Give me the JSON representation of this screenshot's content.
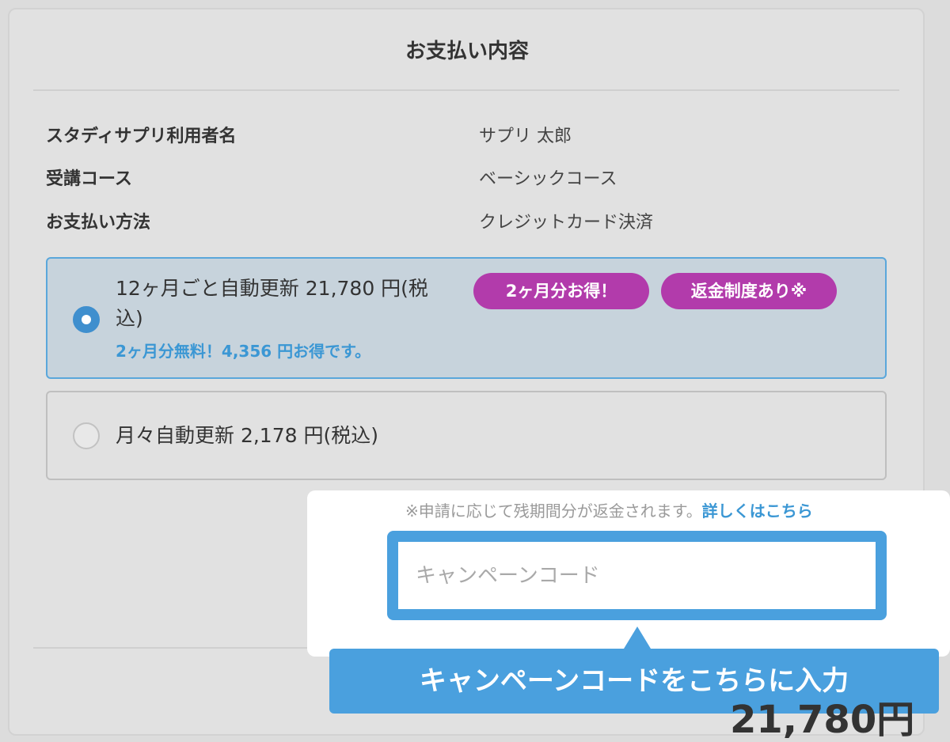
{
  "title": "お支払い内容",
  "details": [
    {
      "label": "スタディサプリ利用者名",
      "value": "サプリ 太郎"
    },
    {
      "label": "受講コース",
      "value": "ベーシックコース"
    },
    {
      "label": "お支払い方法",
      "value": "クレジットカード決済"
    }
  ],
  "plans": {
    "yearly": {
      "line1": "12ヶ月ごと自動更新 21,780 円(税",
      "line2": "込)",
      "note": "2ヶ月分無料！4,356 円お得です。",
      "badges": [
        "2ヶ月分お得！",
        "返金制度あり※"
      ],
      "selected": true
    },
    "monthly": {
      "label": "月々自動更新 2,178 円(税込)",
      "selected": false
    }
  },
  "refund": {
    "note": "※申請に応じて残期間分が返金されます。",
    "link": "詳しくはこちら"
  },
  "campaign": {
    "placeholder": "キャンペーンコード",
    "tooltip": "キャンペーンコードをこちらに入力"
  },
  "total_peek": "21,780円",
  "colors": {
    "accent_blue": "#4aa0de",
    "badge_purple": "#b23bab",
    "selected_bg": "#c7d3dc"
  }
}
